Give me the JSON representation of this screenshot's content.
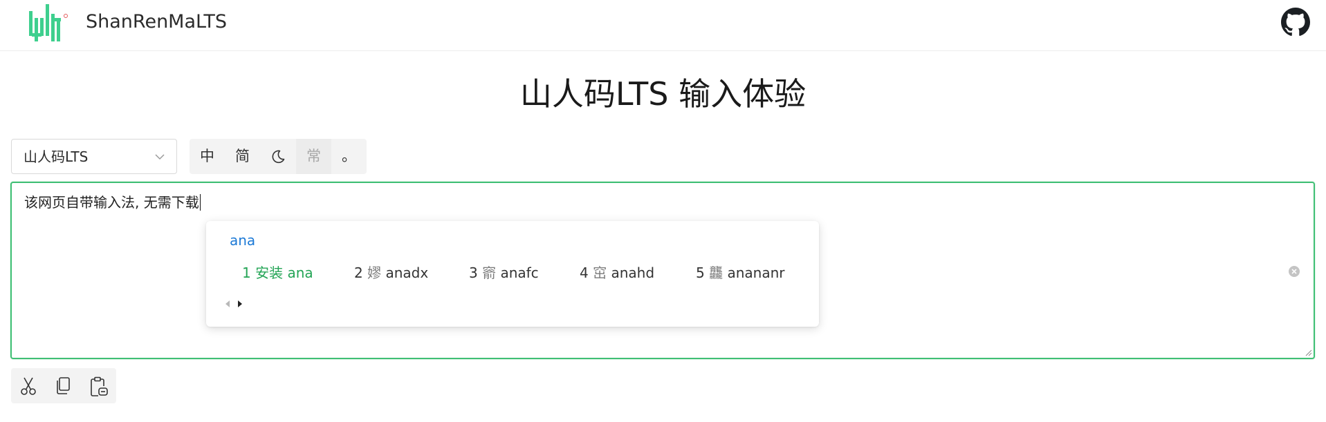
{
  "header": {
    "brand": "ShanRenMaLTS",
    "logo_icon": "shanrenma-logo-icon",
    "github_icon": "github-icon"
  },
  "page": {
    "title": "山人码LTS 输入体验"
  },
  "controls": {
    "scheme_select": {
      "value": "山人码LTS",
      "icon": "chevron-down-icon"
    },
    "toggles": [
      {
        "label": "中",
        "enabled": true
      },
      {
        "label": "简",
        "enabled": true
      },
      {
        "label": "",
        "icon": "moon-icon",
        "enabled": true
      },
      {
        "label": "常",
        "enabled": false
      },
      {
        "label": "。",
        "enabled": true
      }
    ]
  },
  "editor": {
    "text": "该网页自带输入法, 无需下载",
    "clear_icon": "clear-circle-icon"
  },
  "candidate_popup": {
    "preedit": "ana",
    "candidates": [
      {
        "index": "1",
        "text": "安装",
        "code": "ana",
        "selected": true
      },
      {
        "index": "2",
        "text": "嫪",
        "code": "anadx",
        "selected": false
      },
      {
        "index": "3",
        "text": "窬",
        "code": "anafc",
        "selected": false
      },
      {
        "index": "4",
        "text": "窋",
        "code": "anahd",
        "selected": false
      },
      {
        "index": "5",
        "text": "龘",
        "code": "anananr",
        "selected": false
      }
    ],
    "prev_icon": "caret-left-icon",
    "next_icon": "caret-right-icon"
  },
  "toolbar": {
    "items": [
      {
        "name": "cut",
        "icon": "scissors-icon"
      },
      {
        "name": "copy",
        "icon": "copy-icon"
      },
      {
        "name": "paste",
        "icon": "clipboard-icon"
      }
    ]
  },
  "colors": {
    "accent_green": "#3fbf74",
    "selected_candidate": "#23a455",
    "preedit_blue": "#1d7ad6",
    "logo_green": "#3ecf8e"
  }
}
